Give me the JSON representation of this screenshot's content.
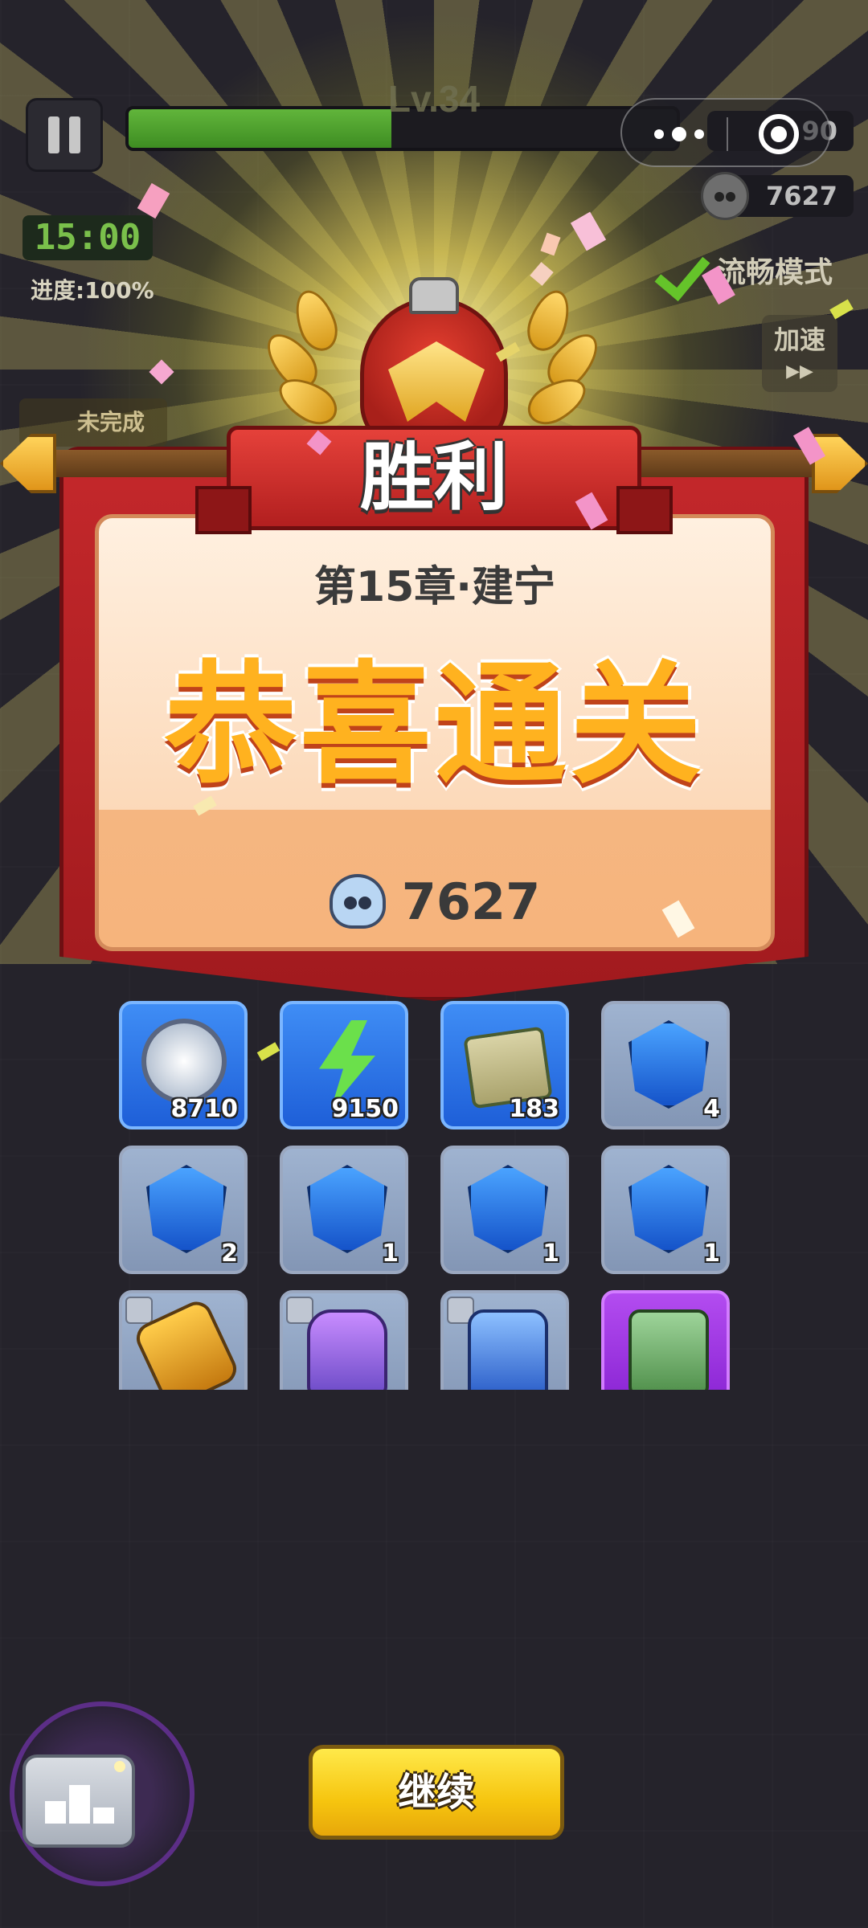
{
  "hud": {
    "level": "Lv.34",
    "xp_progress": 0.48,
    "coins": "90",
    "kills": "7627",
    "timer": "15:00",
    "progress_text": "进度:100%",
    "smooth_mode_label": "流畅模式",
    "speed_label": "加速",
    "speed_arrows": "▶▶",
    "incomplete_label": "未完成"
  },
  "victory": {
    "title": "胜利",
    "chapter": "第15章·建宁",
    "headline": "恭喜通关",
    "kills": "7627"
  },
  "rewards": [
    {
      "name": "silver-coin",
      "qty": "8710",
      "style": "blue"
    },
    {
      "name": "energy-bolt",
      "qty": "9150",
      "style": "blue"
    },
    {
      "name": "ancient-scroll",
      "qty": "183",
      "style": "blue"
    },
    {
      "name": "helmet-gem",
      "qty": "4",
      "style": "gray"
    },
    {
      "name": "medal-gem",
      "qty": "2",
      "style": "gray"
    },
    {
      "name": "boot-gem",
      "qty": "1",
      "style": "gray"
    },
    {
      "name": "sword-gem",
      "qty": "1",
      "style": "gray"
    },
    {
      "name": "scroll-gem",
      "qty": "1",
      "style": "gray"
    },
    {
      "name": "amulet-equipment",
      "qty": "",
      "style": "gray"
    },
    {
      "name": "armor-equipment",
      "qty": "",
      "style": "gray"
    },
    {
      "name": "robe-equipment",
      "qty": "",
      "style": "gray"
    },
    {
      "name": "jade-turtle-seal",
      "qty": "",
      "style": "purple"
    }
  ],
  "buttons": {
    "continue": "继续"
  },
  "colors": {
    "background": "#25232b",
    "banner_red": "#c4282b",
    "headline_gold": "#ffb21f",
    "button_yellow": "#f6c50f"
  }
}
